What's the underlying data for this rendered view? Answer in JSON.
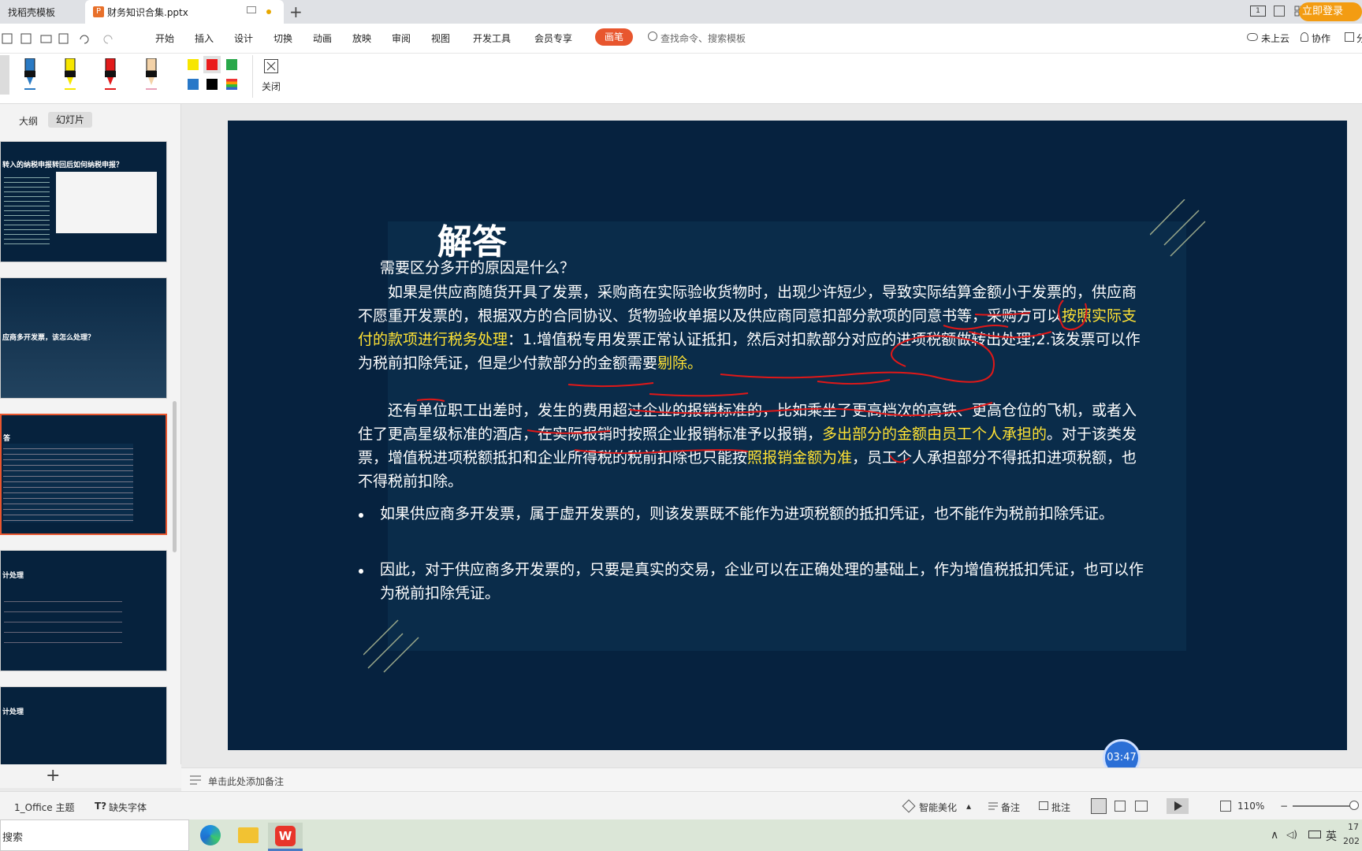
{
  "titlebar": {
    "tabs": [
      {
        "label": "找稻壳模板"
      },
      {
        "label": "财务知识合集.pptx"
      }
    ],
    "new_tab": "+",
    "login_button": "立即登录",
    "page_indicator": "1"
  },
  "menubar": {
    "items": [
      "开始",
      "插入",
      "设计",
      "切换",
      "动画",
      "放映",
      "审阅",
      "视图",
      "开发工具",
      "会员专享"
    ],
    "active_pen": "画笔",
    "search_placeholder": "查找命令、搜索模板",
    "cloud_status": "未上云",
    "collab": "协作",
    "share": "分"
  },
  "penbar": {
    "close_label": "关闭",
    "pens": [
      "blue-highlighter",
      "yellow-highlighter",
      "red-highlighter",
      "beige-highlighter"
    ],
    "colors_row1": [
      "#f7e600",
      "#ea1c1c",
      "#29a84a"
    ],
    "colors_row2": [
      "#2878c8",
      "#000000",
      "multi"
    ]
  },
  "leftpane": {
    "tabs": [
      "大纲",
      "幻灯片"
    ],
    "thumbs": [
      {
        "title": "转入的纳税申报转回后如何纳税申报？"
      },
      {
        "title": "应商多开发票，该怎么处理？"
      },
      {
        "title": "答"
      },
      {
        "title": "计处理"
      },
      {
        "title": "计处理"
      }
    ],
    "add_slide": "+"
  },
  "slide": {
    "title": "解答",
    "question": "需要区分多开的原因是什么？",
    "p1_a": "如果是供应商随货开具了发票，采购商在实际验收货物时，出现少许短少，导致实际结算金额小于发票的，供应商不愿重开发票的，根据双方的合同协议、货物验收单据以及供应商同意扣部分款项的同意书等，采购方可以",
    "p1_y": "按照实际支付的款项进行税务处理",
    "p1_b": "：1.增值税专用发票正常认证抵扣，然后对扣款部分对应的进项税额做转出处理;2.该发票可以作为税前扣除凭证，但是少付款部分的金额需要",
    "p1_y2": "剔除。",
    "p2_a": "还有单位职工出差时，发生的费用超过企业的报销标准的，比如乘坐了更高档次的高铁、更高仓位的飞机，或者入住了更高星级标准的酒店，在实际报销时按照企业报销标准予以报销，",
    "p2_y": "多出部分的金额由员工个人承担的",
    "p2_b": "。对于该类发票，增值税进项税额抵扣和企业所得税的税前扣除也只能按",
    "p2_y2": "照报销金额为准",
    "p2_c": "，员工个人承担部分不得抵扣进项税额，也不得税前扣除。",
    "bullet1": "如果供应商多开发票，属于虚开发票的，则该发票既不能作为进项税额的抵扣凭证，也不能作为税前扣除凭证。",
    "bullet2": "因此，对于供应商多开发票的，只要是真实的交易，企业可以在正确处理的基础上，作为增值税抵扣凭证，也可以作为税前扣除凭证。",
    "timer": "03:47"
  },
  "notes": {
    "placeholder": "单击此处添加备注"
  },
  "status": {
    "theme": "1_Office 主题",
    "missing_font": "缺失字体",
    "beautify": "智能美化",
    "notes": "备注",
    "comments": "批注",
    "zoom": "110%"
  },
  "taskbar": {
    "search": "搜索",
    "ime": "英",
    "time": "17",
    "date": "202"
  }
}
